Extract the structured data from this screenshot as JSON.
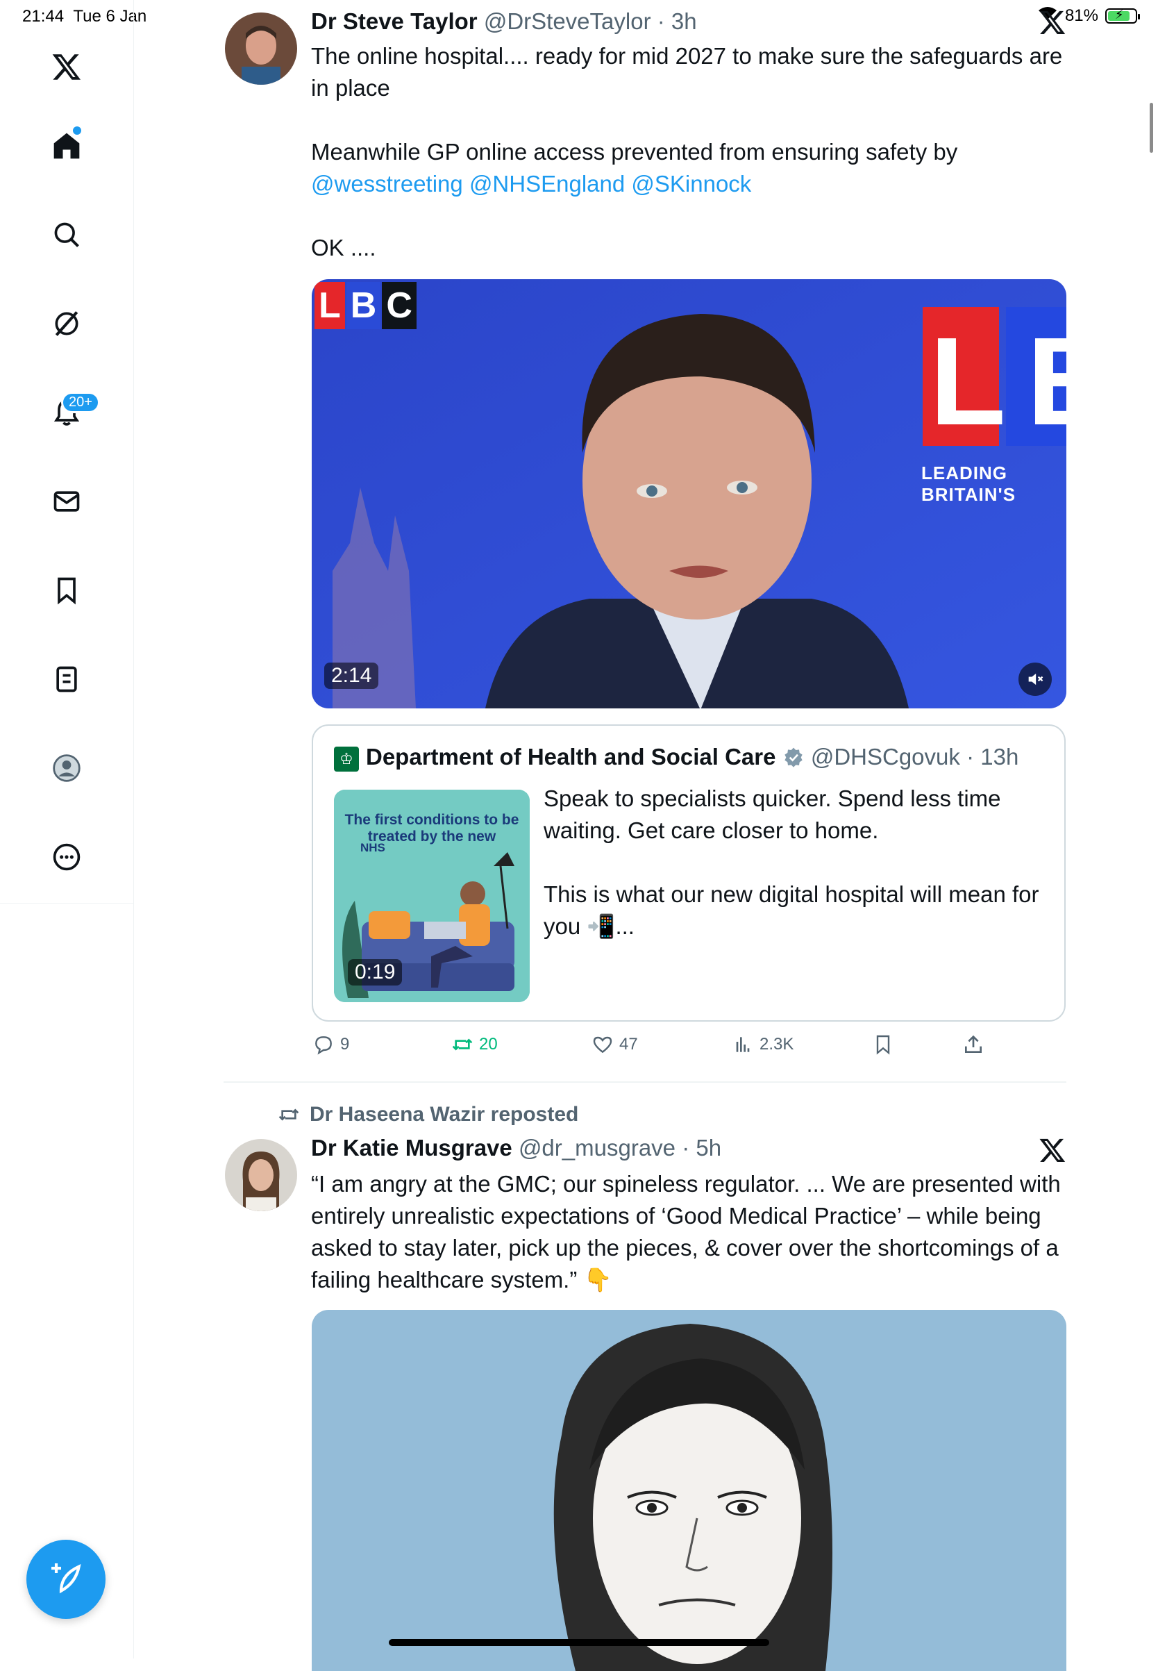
{
  "status": {
    "time": "21:44",
    "date": "Tue 6 Jan",
    "battery": "81%",
    "battery_level": 0.81
  },
  "sidebar": {
    "items": [
      {
        "icon": "x-logo-icon"
      },
      {
        "icon": "home-icon"
      },
      {
        "icon": "search-icon"
      },
      {
        "icon": "grok-icon"
      },
      {
        "icon": "notifications-icon",
        "badge": "20+"
      },
      {
        "icon": "messages-icon"
      },
      {
        "icon": "bookmarks-icon"
      },
      {
        "icon": "lists-icon"
      },
      {
        "icon": "profile-icon"
      },
      {
        "icon": "more-icon"
      }
    ],
    "compose_icon": "compose-post-icon"
  },
  "tweet1": {
    "name": "Dr Steve Taylor",
    "handle": "@DrSteveTaylor",
    "time": "3h",
    "text_line1": "The online hospital.... ready for mid 2027 to make sure the safeguards are in place",
    "text_line2": "Meanwhile GP online access prevented from ensuring safety by",
    "mentions": [
      "@wesstreeting",
      "@NHSEngland",
      "@SKinnock"
    ],
    "text_line3": "OK ....",
    "video": {
      "logo": "LBC",
      "big_logo": "LB",
      "tagline": "LEADING BRITAIN'S",
      "duration": "2:14"
    },
    "quote": {
      "name": "Department of Health and Social Care",
      "handle": "@DHSCgovuk",
      "time": "13h",
      "text_line1": "Speak to specialists quicker. Spend less time waiting. Get care closer to home.",
      "text_line2": "This is what our new digital hospital will mean for you 📲...",
      "thumb_title": "The first conditions to be treated by the new",
      "thumb_sub": "NHS",
      "thumb_duration": "0:19"
    },
    "actions": {
      "replies": "9",
      "reposts": "20",
      "likes": "47",
      "views": "2.3K"
    }
  },
  "tweet2": {
    "repost_by": "Dr Haseena Wazir reposted",
    "name": "Dr Katie Musgrave",
    "handle": "@dr_musgrave",
    "time": "5h",
    "text": "“I am angry at the GMC; our spineless regulator. ... We are presented with entirely unrealistic expectations of ‘Good Medical Practice’ – while being asked to stay later, pick up the pieces, & cover over the shortcomings of a failing healthcare system.” 👇"
  },
  "colors": {
    "accent": "#1d9bf0",
    "repost_green": "#00ba7c",
    "muted": "#536471"
  }
}
